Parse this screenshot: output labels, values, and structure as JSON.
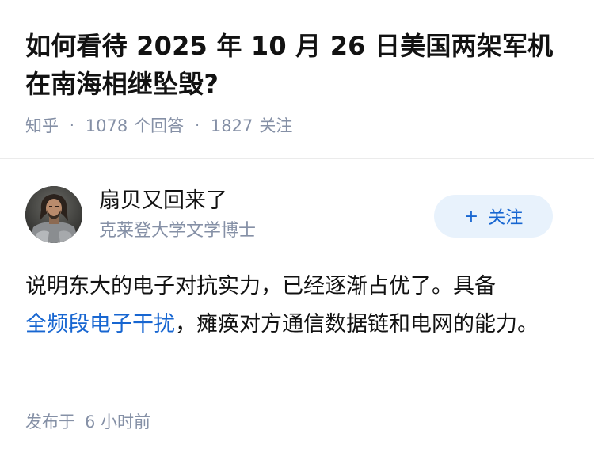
{
  "question": {
    "title": "如何看待 2025 年 10 月 26 日美国两架军机在南海相继坠毁?",
    "source": "知乎",
    "answer_count": "1078",
    "answer_label": "个回答",
    "follower_count": "1827",
    "follower_label": "关注"
  },
  "author": {
    "name": "扇贝又回来了",
    "bio": "克莱登大学文学博士",
    "avatar_icon": "knight-avatar"
  },
  "follow_button": {
    "icon": "+",
    "label": "关注"
  },
  "answer": {
    "text_before": "说明东大的电子对抗实力，已经逐渐占优了。具备",
    "link_text": "全频段电子干扰",
    "text_after": "，瘫痪对方通信数据链和电网的能力。"
  },
  "timestamp": {
    "prefix": "发布于",
    "value": "6 小时前"
  },
  "colors": {
    "accent": "#1766d1",
    "muted": "#8590a6",
    "button_bg": "#e8f2fc"
  }
}
